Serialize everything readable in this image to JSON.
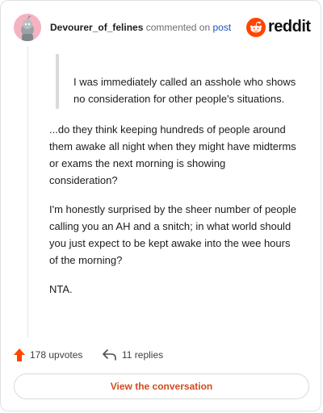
{
  "comment": {
    "username": "Devourer_of_felines",
    "action_text": "commented on",
    "post_link": "post",
    "quote": "I was immediately called an asshole who shows no consideration for other people's situations.",
    "paragraphs": [
      "...do they think keeping hundreds of people around them awake all night when they might have midterms or exams the next morning is showing consideration?",
      "I'm honestly surprised by the sheer number of people calling you an AH and a snitch; in what world should you just expect to be kept awake into the wee hours of the morning?",
      "NTA."
    ]
  },
  "brand": {
    "name": "reddit",
    "accent": "#ff4500"
  },
  "stats": {
    "upvotes": "178 upvotes",
    "replies": "11 replies"
  },
  "button": {
    "view_conversation": "View the conversation"
  },
  "icons": [
    "snoo-avatar-icon",
    "reddit-logo-icon",
    "upvote-arrow-icon",
    "reply-arrow-icon"
  ]
}
